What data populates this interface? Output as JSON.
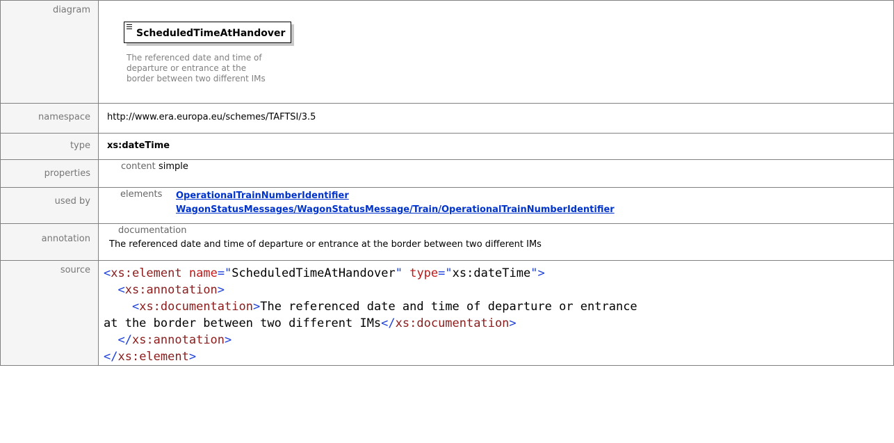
{
  "labels": {
    "diagram": "diagram",
    "namespace": "namespace",
    "type": "type",
    "properties": "properties",
    "used_by": "used by",
    "annotation": "annotation",
    "source": "source"
  },
  "diagram": {
    "element_name": "ScheduledTimeAtHandover",
    "documentation": "The referenced date and time of departure or entrance at the border between two different IMs"
  },
  "namespace": "http://www.era.europa.eu/schemes/TAFTSI/3.5",
  "type": "xs:dateTime",
  "properties": {
    "key": "content",
    "value": "simple"
  },
  "used_by": {
    "key": "elements",
    "links": [
      "OperationalTrainNumberIdentifier",
      "WagonStatusMessages/WagonStatusMessage/Train/OperationalTrainNumberIdentifier"
    ]
  },
  "annotation": {
    "key": "documentation",
    "text": "The referenced date and time of departure or entrance at the border between two different IMs"
  },
  "source": {
    "element_tag": "xs:element",
    "name_attr": "name",
    "name_value": "ScheduledTimeAtHandover",
    "type_attr": "type",
    "type_value": "xs:dateTime",
    "annotation_tag": "xs:annotation",
    "documentation_tag": "xs:documentation",
    "doc_text_1": "The referenced date and time of departure or entrance",
    "doc_text_2": "at the border between two different IMs"
  },
  "colors": {
    "link": "#0033cc",
    "tag": "#8b1c1c",
    "bracket": "#1c3fd9",
    "attribute": "#c01818"
  }
}
